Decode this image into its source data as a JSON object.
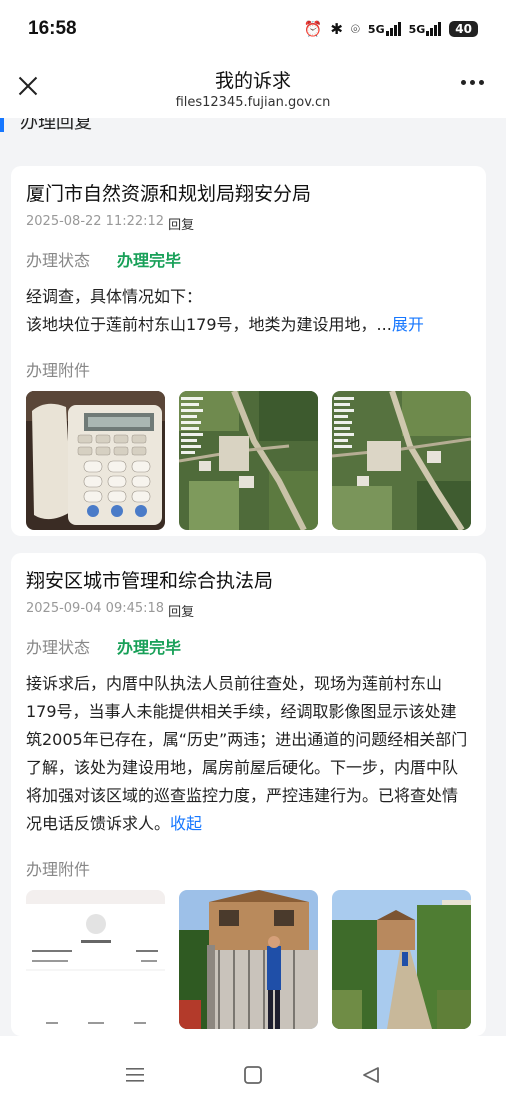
{
  "status_bar": {
    "time": "16:58",
    "network_1": "5G",
    "network_2": "5G",
    "battery": "40"
  },
  "nav": {
    "title": "我的诉求",
    "url": "files12345.fujian.gov.cn"
  },
  "section": {
    "title": "办理回复"
  },
  "replies": [
    {
      "org": "厦门市自然资源和规划局翔安分局",
      "time": "2025-08-22 11:22:12",
      "reply_label": "回复",
      "status_label": "办理状态",
      "status_value": "办理完毕",
      "body_line1": "经调查，具体情况如下：",
      "body_line2": "该地块位于莲前村东山179号，地类为建设用地，...",
      "toggle_label": "展开",
      "attachments_label": "办理附件"
    },
    {
      "org": "翔安区城市管理和综合执法局",
      "time": "2025-09-04 09:45:18",
      "reply_label": "回复",
      "status_label": "办理状态",
      "status_value": "办理完毕",
      "body": "接诉求后，内厝中队执法人员前往查处，现场为莲前村东山179号，当事人未能提供相关手续，经调取影像图显示该处建筑2005年已存在，属“历史”两违；进出通道的问题经相关部门了解，该处为建设用地，属房前屋后硬化。下一步，内厝中队将加强对该区域的巡查监控力度，严控违建行为。已将查处情况电话反馈诉求人。",
      "toggle_label": "收起",
      "attachments_label": "办理附件"
    }
  ],
  "colors": {
    "accent": "#1677ff",
    "status_done": "#18a058"
  }
}
